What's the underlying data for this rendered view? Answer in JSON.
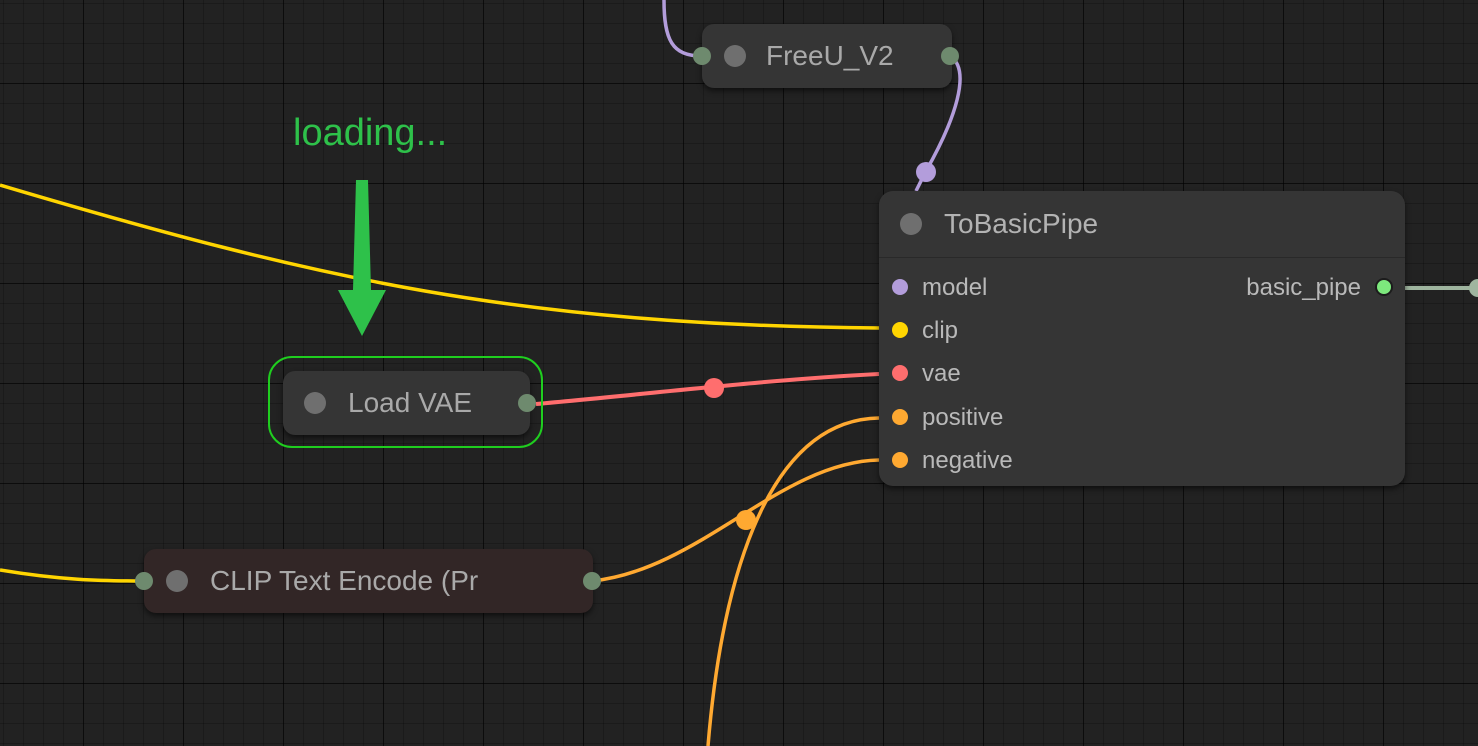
{
  "annotation": {
    "loading_text": "loading..."
  },
  "nodes": {
    "freeu": {
      "title": "FreeU_V2"
    },
    "load_vae": {
      "title": "Load VAE",
      "highlight_color": "#1fce1f"
    },
    "clip_text_encode": {
      "title": "CLIP Text Encode (Pr"
    },
    "to_basic_pipe": {
      "title": "ToBasicPipe",
      "inputs": [
        {
          "name": "model",
          "color": "#b39ddb"
        },
        {
          "name": "clip",
          "color": "#ffd500"
        },
        {
          "name": "vae",
          "color": "#ff6e6e"
        },
        {
          "name": "positive",
          "color": "#ffa931"
        },
        {
          "name": "negative",
          "color": "#ffa931"
        }
      ],
      "outputs": [
        {
          "name": "basic_pipe",
          "color": "#7de87d"
        }
      ]
    }
  },
  "link_colors": {
    "model": "#b39ddb",
    "clip": "#ffd500",
    "vae": "#ff6e6e",
    "conditioning": "#ffa931",
    "basic_pipe": "#9fb59f"
  }
}
